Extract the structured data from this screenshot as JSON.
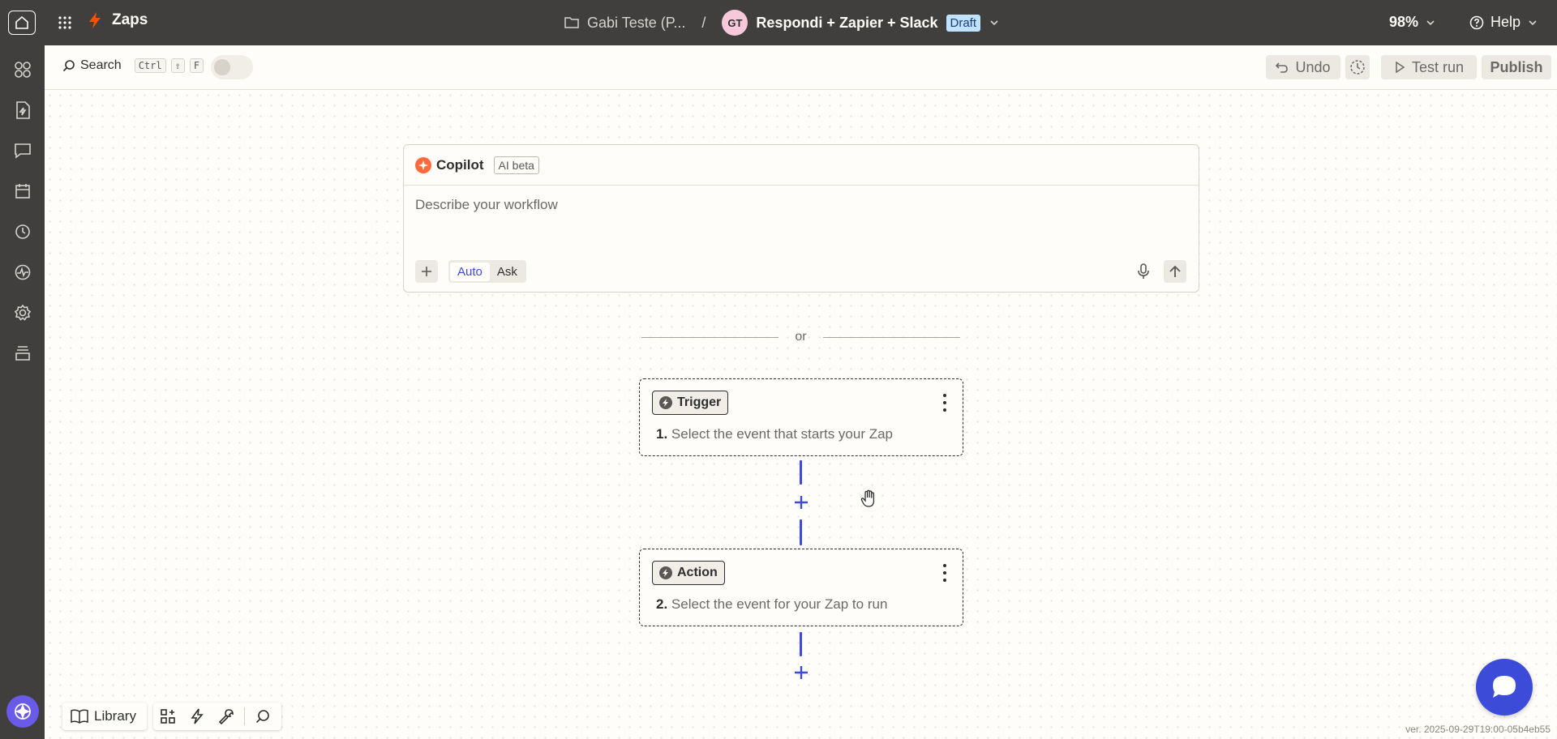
{
  "topbar": {
    "app_title": "Zaps",
    "folder_name": "Gabi Teste (P...",
    "separator": "/",
    "avatar_initials": "GT",
    "zap_title": "Respondi + Zapier + Slack",
    "status_badge": "Draft",
    "zoom": "98%",
    "help": "Help"
  },
  "sidebar": {
    "items": [
      "apps-icon",
      "zap-file-icon",
      "chat-icon",
      "calendar-icon",
      "history-icon",
      "activity-icon",
      "settings-icon",
      "layers-icon"
    ]
  },
  "toolbar": {
    "search_label": "Search",
    "shortcut_keys": [
      "Ctrl",
      "⇧",
      "F"
    ],
    "undo_label": "Undo",
    "test_run_label": "Test run",
    "publish_label": "Publish"
  },
  "copilot": {
    "title": "Copilot",
    "badge": "AI beta",
    "placeholder": "Describe your workflow",
    "modes": [
      "Auto",
      "Ask"
    ],
    "active_mode": "Auto"
  },
  "divider": {
    "text": "or"
  },
  "steps": [
    {
      "badge": "Trigger",
      "number": "1.",
      "description": "Select the event that starts your Zap"
    },
    {
      "badge": "Action",
      "number": "2.",
      "description": "Select the event for your Zap to run"
    }
  ],
  "bottom": {
    "library_label": "Library"
  },
  "version": "ver. 2025-09-29T19:00-05b4eb55",
  "colors": {
    "topbar": "#403f3e",
    "accent": "#3d4bd9",
    "brand": "#ff4f00",
    "draft_badge": "#bfe2ff"
  }
}
